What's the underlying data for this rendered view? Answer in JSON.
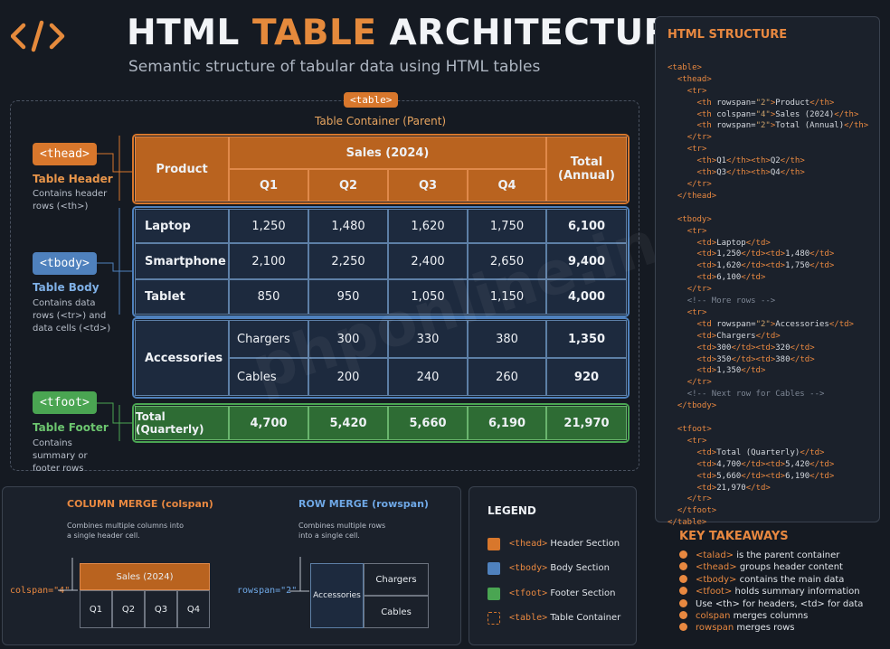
{
  "header": {
    "title_part1": "HTML",
    "title_accent": "TABLE",
    "title_part2": "ARCHITECTURE",
    "subtitle": "Semantic structure of tabular data using HTML tables"
  },
  "container": {
    "tag": "<table>",
    "label": "Table Container (Parent)"
  },
  "sections": {
    "thead": {
      "tag": "<thead>",
      "name": "Table Header",
      "desc": "Contains header rows (<th>)"
    },
    "tbody": {
      "tag": "<tbody>",
      "name": "Table Body",
      "desc": "Contains data rows (<tr>) and data cells (<td>)"
    },
    "tfoot": {
      "tag": "<tfoot>",
      "name": "Table Footer",
      "desc": "Contains summary or footer rows"
    }
  },
  "table": {
    "head": {
      "product": "Product",
      "sales": "Sales (2024)",
      "total": "Total (Annual)",
      "quarters": [
        "Q1",
        "Q2",
        "Q3",
        "Q4"
      ]
    },
    "body": [
      {
        "product": "Laptop",
        "q": [
          "1,250",
          "1,480",
          "1,620",
          "1,750"
        ],
        "total": "6,100"
      },
      {
        "product": "Smartphone",
        "q": [
          "2,100",
          "2,250",
          "2,400",
          "2,650"
        ],
        "total": "9,400"
      },
      {
        "product": "Tablet",
        "q": [
          "850",
          "950",
          "1,050",
          "1,150"
        ],
        "total": "4,000"
      }
    ],
    "accessories": {
      "label": "Accessories",
      "rows": [
        {
          "sub": "Chargers",
          "q": [
            "300",
            "330",
            "380"
          ],
          "total": "1,350"
        },
        {
          "sub": "Cables",
          "q": [
            "200",
            "240",
            "260"
          ],
          "total": "920"
        }
      ]
    },
    "foot": {
      "label": "Total (Quarterly)",
      "q": [
        "4,700",
        "5,420",
        "5,660",
        "6,190"
      ],
      "total": "21,970"
    }
  },
  "colspan_box": {
    "title": "COLUMN MERGE (colspan)",
    "desc": "Combines multiple columns into a single header cell.",
    "attr": "colspan=\"4\"",
    "header": "Sales (2024)",
    "cells": [
      "Q1",
      "Q2",
      "Q3",
      "Q4"
    ]
  },
  "rowspan_box": {
    "title": "ROW MERGE (rowspan)",
    "desc": "Combines multiple rows into a single cell.",
    "attr": "rowspan=\"2\"",
    "merged": "Accessories",
    "cells": [
      "Chargers",
      "Cables"
    ]
  },
  "legend": {
    "title": "LEGEND",
    "items": [
      {
        "tag": "<thead>",
        "label": "Header Section",
        "color": "#d8772c"
      },
      {
        "tag": "<tbody>",
        "label": "Body Section",
        "color": "#4f81bd"
      },
      {
        "tag": "<tfoot>",
        "label": "Footer Section",
        "color": "#4aa552"
      },
      {
        "tag": "<table>",
        "label": "Table Container",
        "color": "#d8772c"
      }
    ]
  },
  "structure": {
    "title": "HTML STRUCTURE"
  },
  "takeaways": {
    "title": "KEY TAKEAWAYS",
    "items": [
      {
        "code": "<talad>",
        "text": " is the parent container"
      },
      {
        "code": "<thead>",
        "text": " groups header content"
      },
      {
        "code": "<tbody>",
        "text": " contains the main data"
      },
      {
        "code": "<tfoot>",
        "text": " holds summary information"
      },
      {
        "code": "",
        "text": "Use <th> for headers, <td> for data"
      },
      {
        "code": "colspan",
        "text": " merges columns"
      },
      {
        "code": "rowspan",
        "text": " merges rows"
      }
    ]
  },
  "watermark": "phponline.in",
  "colors": {
    "header": "#b9631f",
    "body": "#1d2a3e",
    "footer": "#2e6c34",
    "accent": "#e58a3c"
  }
}
